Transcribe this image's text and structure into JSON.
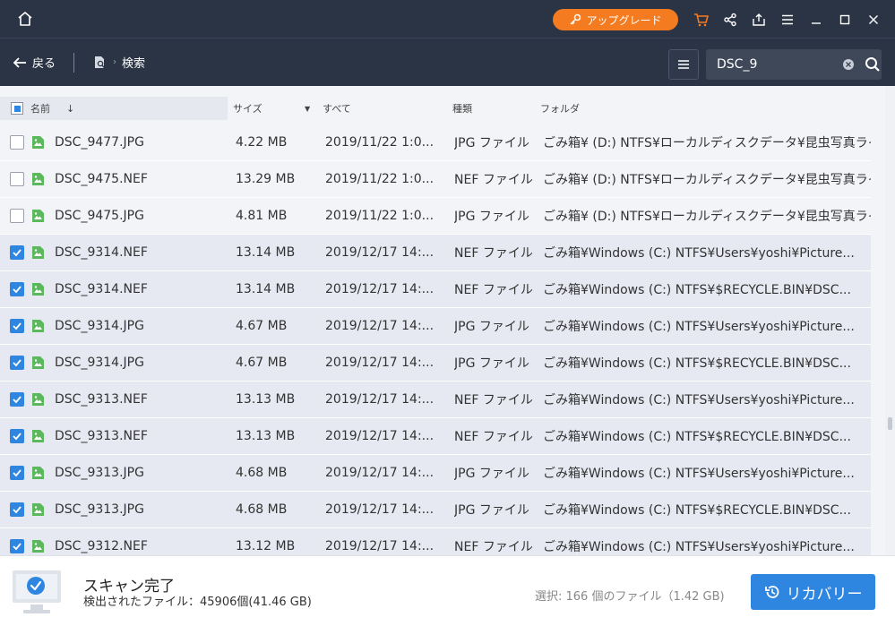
{
  "titlebar": {
    "upgrade_label": "アップグレード",
    "icons": [
      "home-icon",
      "cart-icon",
      "share-icon",
      "export-icon",
      "menu-icon",
      "minimize-icon",
      "maximize-icon",
      "close-icon"
    ]
  },
  "toolbar": {
    "back_label": "戻る",
    "breadcrumb_label": "検索",
    "search_value": "DSC_9"
  },
  "table": {
    "headers": {
      "name": "名前",
      "size": "サイズ",
      "date": "すべて",
      "type": "種類",
      "folder": "フォルダ"
    },
    "rows": [
      {
        "checked": false,
        "name": "DSC_9477.JPG",
        "size": "4.22 MB",
        "date": "2019/11/22 1:0...",
        "type": "JPG ファイル",
        "folder": "ごみ箱¥ (D:) NTFS¥ローカルディスクデータ¥昆虫写真ライ..."
      },
      {
        "checked": false,
        "name": "DSC_9475.NEF",
        "size": "13.29 MB",
        "date": "2019/11/22 1:0...",
        "type": "NEF ファイル",
        "folder": "ごみ箱¥ (D:) NTFS¥ローカルディスクデータ¥昆虫写真ライ..."
      },
      {
        "checked": false,
        "name": "DSC_9475.JPG",
        "size": "4.81 MB",
        "date": "2019/11/22 1:0...",
        "type": "JPG ファイル",
        "folder": "ごみ箱¥ (D:) NTFS¥ローカルディスクデータ¥昆虫写真ライ..."
      },
      {
        "checked": true,
        "name": "DSC_9314.NEF",
        "size": "13.14 MB",
        "date": "2019/12/17 14:...",
        "type": "NEF ファイル",
        "folder": "ごみ箱¥Windows (C:) NTFS¥Users¥yoshi¥Picture..."
      },
      {
        "checked": true,
        "name": "DSC_9314.NEF",
        "size": "13.14 MB",
        "date": "2019/12/17 14:...",
        "type": "NEF ファイル",
        "folder": "ごみ箱¥Windows (C:) NTFS¥$RECYCLE.BIN¥DSC..."
      },
      {
        "checked": true,
        "name": "DSC_9314.JPG",
        "size": "4.67 MB",
        "date": "2019/12/17 14:...",
        "type": "JPG ファイル",
        "folder": "ごみ箱¥Windows (C:) NTFS¥Users¥yoshi¥Picture..."
      },
      {
        "checked": true,
        "name": "DSC_9314.JPG",
        "size": "4.67 MB",
        "date": "2019/12/17 14:...",
        "type": "JPG ファイル",
        "folder": "ごみ箱¥Windows (C:) NTFS¥$RECYCLE.BIN¥DSC..."
      },
      {
        "checked": true,
        "name": "DSC_9313.NEF",
        "size": "13.13 MB",
        "date": "2019/12/17 14:...",
        "type": "NEF ファイル",
        "folder": "ごみ箱¥Windows (C:) NTFS¥Users¥yoshi¥Picture..."
      },
      {
        "checked": true,
        "name": "DSC_9313.NEF",
        "size": "13.13 MB",
        "date": "2019/12/17 14:...",
        "type": "NEF ファイル",
        "folder": "ごみ箱¥Windows (C:) NTFS¥$RECYCLE.BIN¥DSC..."
      },
      {
        "checked": true,
        "name": "DSC_9313.JPG",
        "size": "4.68 MB",
        "date": "2019/12/17 14:...",
        "type": "JPG ファイル",
        "folder": "ごみ箱¥Windows (C:) NTFS¥Users¥yoshi¥Picture..."
      },
      {
        "checked": true,
        "name": "DSC_9313.JPG",
        "size": "4.68 MB",
        "date": "2019/12/17 14:...",
        "type": "JPG ファイル",
        "folder": "ごみ箱¥Windows (C:) NTFS¥$RECYCLE.BIN¥DSC..."
      },
      {
        "checked": true,
        "name": "DSC_9312.NEF",
        "size": "13.12 MB",
        "date": "2019/12/17 14:...",
        "type": "NEF ファイル",
        "folder": "ごみ箱¥Windows (C:) NTFS¥Users¥yoshi¥Picture..."
      }
    ]
  },
  "footer": {
    "scan_title": "スキャン完了",
    "scan_detail": "検出されたファイル：45906個(41.46 GB)",
    "selection_info": "選択: 166 個のファイル（1.42 GB)",
    "recover_label": "リカバリー"
  },
  "colors": {
    "header_bg": "#2b3445",
    "accent": "#2f86e0",
    "upgrade": "#f47b20",
    "file_icon": "#5cb85c"
  }
}
